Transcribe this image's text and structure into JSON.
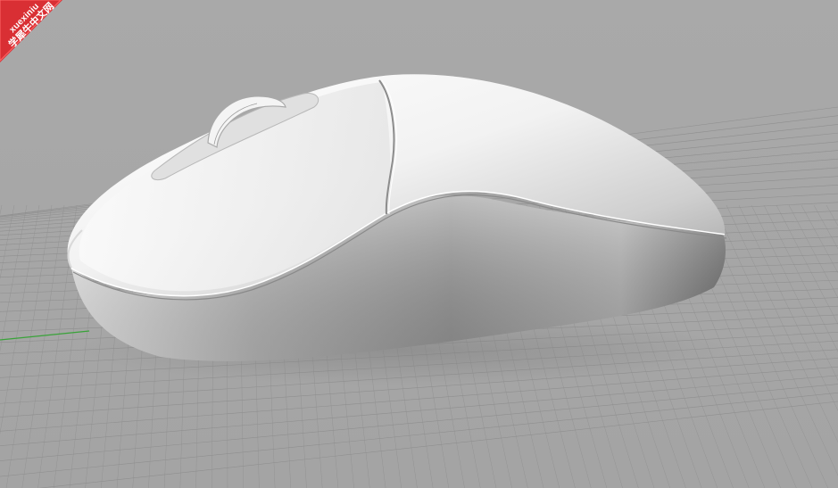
{
  "watermark": {
    "brand": "xuexiniu",
    "chinese": "学犀牛中文网",
    "color": "#d92f34"
  },
  "viewport": {
    "background_color": "#a7a7a7",
    "grid_color": "#8f8f8f",
    "axis_x_color": "#3b9b3b"
  },
  "model": {
    "object_name": "computer-mouse-render",
    "surface_color": "#eeeeee"
  }
}
